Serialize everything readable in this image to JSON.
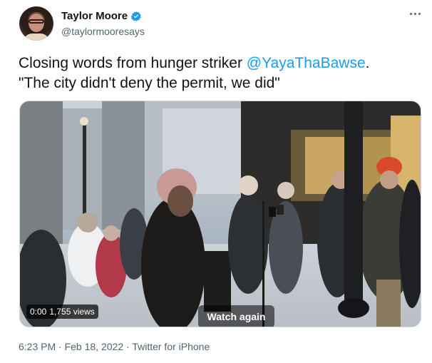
{
  "author": {
    "display_name": "Taylor Moore",
    "handle": "@taylormooresays",
    "verified": true
  },
  "tweet": {
    "text_before": "Closing words from hunger striker ",
    "mention": "@YayaThaBawse",
    "text_after": ".\n\"The city didn't deny the permit, we did\""
  },
  "video": {
    "overlay_label": "Watch again",
    "elapsed": "0:00",
    "views": "1,755 views"
  },
  "footer": {
    "time": "6:23 PM",
    "separator": "·",
    "date": "Feb 18, 2022",
    "source": "Twitter for iPhone"
  },
  "colors": {
    "link": "#1d9bf0",
    "verified": "#1d9bf0",
    "secondary_text": "#536471"
  },
  "icons": [
    "verified-badge-icon",
    "more-options-icon"
  ]
}
